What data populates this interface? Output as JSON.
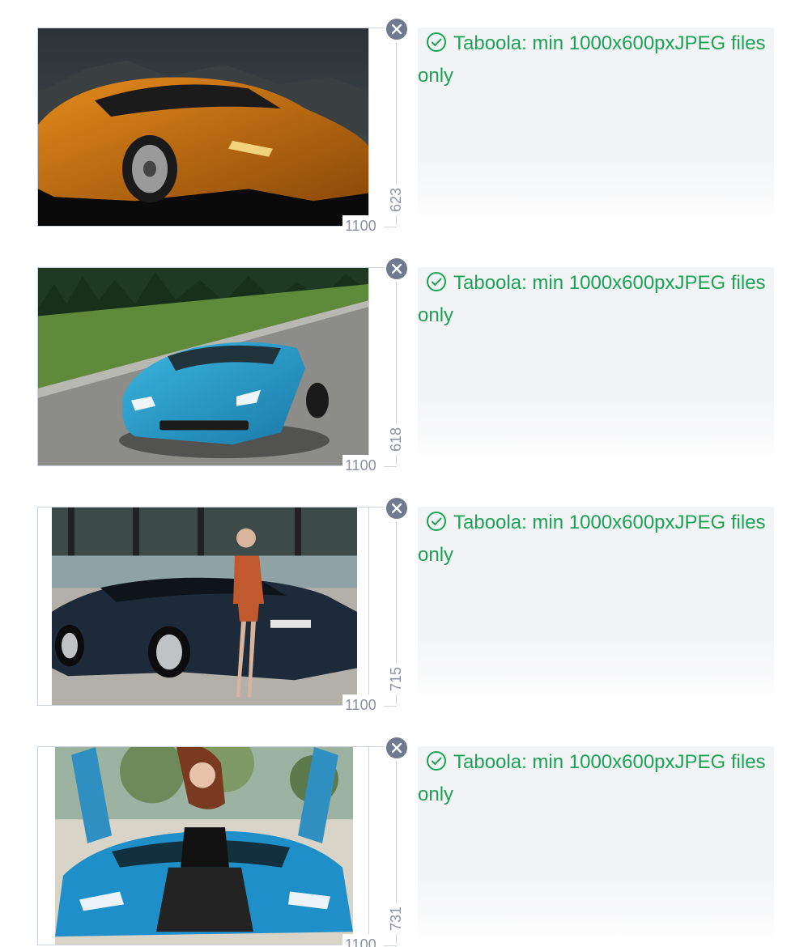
{
  "items": [
    {
      "width_label": "1100",
      "height_label": "623",
      "status_icon": "check-circle-icon",
      "status_text": "Taboola: min 1000x600pxJPEG files only",
      "thumbnail": "orange-lamborghini-huracan-mountains"
    },
    {
      "width_label": "1100",
      "height_label": "618",
      "status_icon": "check-circle-icon",
      "status_text": "Taboola: min 1000x600pxJPEG files only",
      "thumbnail": "blue-lamborghini-roadster-on-road"
    },
    {
      "width_label": "1100",
      "height_label": "715",
      "status_icon": "check-circle-icon",
      "status_text": "Taboola: min 1000x600pxJPEG files only",
      "thumbnail": "woman-leaning-on-dark-blue-lamborghini"
    },
    {
      "width_label": "1100",
      "height_label": "731",
      "status_icon": "check-circle-icon",
      "status_text": "Taboola: min 1000x600pxJPEG files only",
      "thumbnail": "woman-sitting-on-blue-lamborghini-doors-open"
    }
  ],
  "colors": {
    "status_green": "#1aa352",
    "remove_button": "#6f7a92",
    "dimension_text": "#8b93a3",
    "border": "#cdd3dd",
    "panel_bg": "#f3f4f6"
  }
}
